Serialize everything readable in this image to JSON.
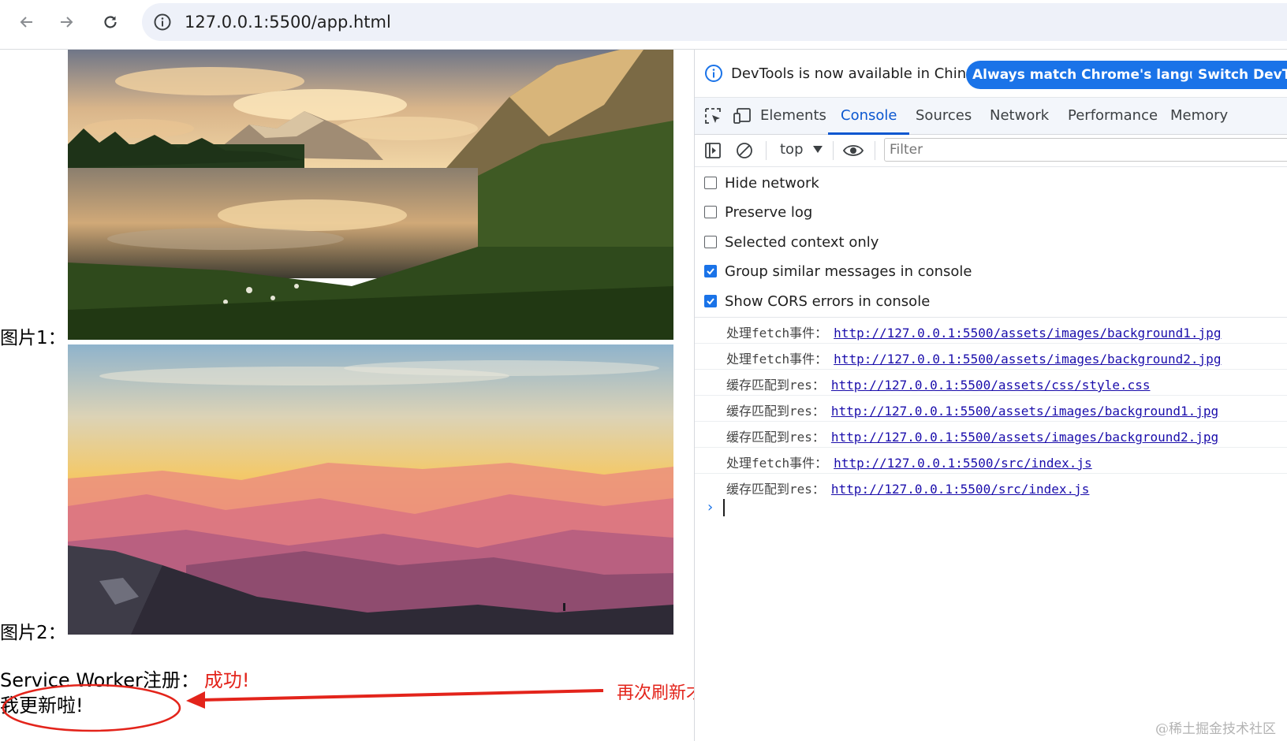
{
  "browser": {
    "url": "127.0.0.1:5500/app.html"
  },
  "page": {
    "image1_label": "图片1：",
    "image2_label": "图片2：",
    "sw_label": "Service Worker注册：",
    "sw_status": "成功!",
    "update_text": "我更新啦!",
    "annotation": "再次刷新才出现",
    "watermark": "@稀土掘金技术社区",
    "colors": {
      "status": "#e3241b",
      "annotation": "#e3241b"
    }
  },
  "devtools": {
    "infobar": {
      "message": "DevTools is now available in Chinese!",
      "button1": "Always match Chrome's language",
      "button2": "Switch DevTo"
    },
    "tabs": [
      "Elements",
      "Console",
      "Sources",
      "Network",
      "Performance",
      "Memory"
    ],
    "active_tab": "Console",
    "context": "top",
    "filter_placeholder": "Filter",
    "settings": [
      {
        "label": "Hide network",
        "checked": false
      },
      {
        "label": "Preserve log",
        "checked": false
      },
      {
        "label": "Selected context only",
        "checked": false
      },
      {
        "label": "Group similar messages in console",
        "checked": true
      },
      {
        "label": "Show CORS errors in console",
        "checked": true
      }
    ],
    "logs": [
      {
        "prefix": "处理fetch事件：",
        "url": "http://127.0.0.1:5500/assets/images/background1.jpg"
      },
      {
        "prefix": "处理fetch事件：",
        "url": "http://127.0.0.1:5500/assets/images/background2.jpg"
      },
      {
        "prefix": "缓存匹配到res：",
        "url": "http://127.0.0.1:5500/assets/css/style.css"
      },
      {
        "prefix": "缓存匹配到res：",
        "url": "http://127.0.0.1:5500/assets/images/background1.jpg"
      },
      {
        "prefix": "缓存匹配到res：",
        "url": "http://127.0.0.1:5500/assets/images/background2.jpg"
      },
      {
        "prefix": "处理fetch事件：",
        "url": "http://127.0.0.1:5500/src/index.js"
      },
      {
        "prefix": "缓存匹配到res：",
        "url": "http://127.0.0.1:5500/src/index.js"
      }
    ],
    "accent": "#1a73e8"
  }
}
